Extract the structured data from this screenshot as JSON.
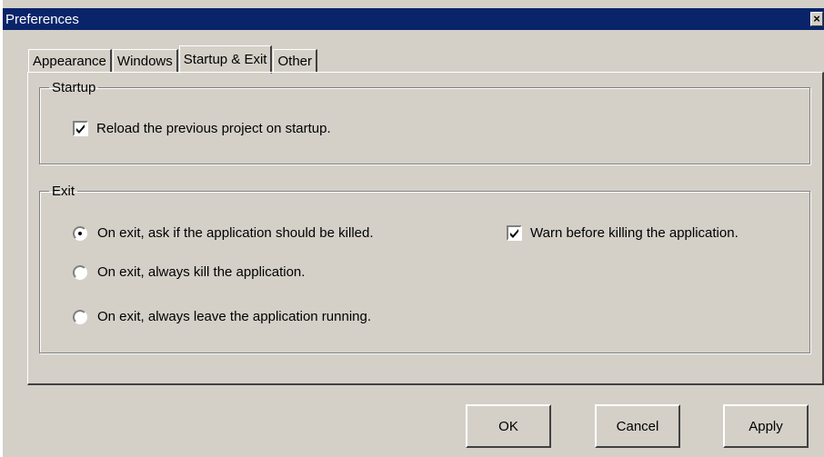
{
  "window": {
    "title": "Preferences"
  },
  "tabs": [
    {
      "label": "Appearance",
      "active": false
    },
    {
      "label": "Windows",
      "active": false
    },
    {
      "label": "Startup & Exit",
      "active": true
    },
    {
      "label": "Other",
      "active": false
    }
  ],
  "startup": {
    "legend": "Startup",
    "reload_label": "Reload the previous project on startup.",
    "reload_checked": true
  },
  "exit": {
    "legend": "Exit",
    "options": [
      {
        "label": "On exit, ask if the application should be killed.",
        "selected": true
      },
      {
        "label": "On exit, always kill the application.",
        "selected": false
      },
      {
        "label": "On exit, always leave the application running.",
        "selected": false
      }
    ],
    "warn_label": "Warn before killing the application.",
    "warn_checked": true
  },
  "buttons": {
    "ok": "OK",
    "cancel": "Cancel",
    "apply": "Apply"
  },
  "icons": {
    "close": "close-icon",
    "check": "checkmark-icon"
  },
  "colors": {
    "titlebar": "#0a246a",
    "face": "#d4d0c8"
  }
}
